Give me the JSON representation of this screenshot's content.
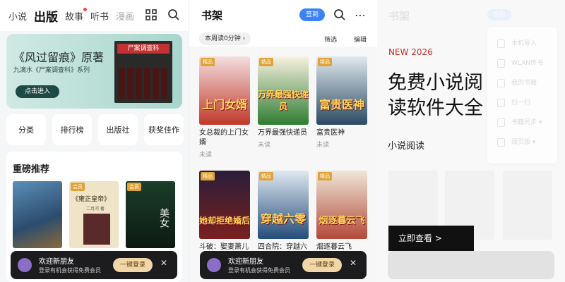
{
  "panel1": {
    "tabs": [
      "小说",
      "出版",
      "故事",
      "听书",
      "漫画"
    ],
    "active_tab": "出版",
    "banner": {
      "title": "《风过留痕》原著",
      "subtitle": "九滴水《尸案调查科》系列",
      "button": "点击进入",
      "book_label": "尸案调查科"
    },
    "categories": [
      "分类",
      "排行榜",
      "出版社",
      "获奖佳作"
    ],
    "section_title": "重磅推荐",
    "covers": [
      {
        "tag": ""
      },
      {
        "tag": "会员",
        "title": "《雍正皇帝》",
        "author": "二月河 著"
      },
      {
        "tag": "会员",
        "title": "美女"
      }
    ],
    "login": {
      "title": "欢迎新朋友",
      "subtitle": "登录有机会获得免费会员",
      "button": "一键登录"
    }
  },
  "panel2": {
    "title": "书架",
    "sign_button": "签到",
    "reading_time": "本周读0分钟",
    "filter": "筛选",
    "edit": "编辑",
    "books": [
      {
        "tag": "精品",
        "cover_text": "上门女婿",
        "title": "女总裁的上门女婿",
        "status": "未读",
        "colors": [
          "#f3dfdf",
          "#c0392b"
        ]
      },
      {
        "tag": "精品",
        "cover_text": "万界最强快递员",
        "title": "万界最强快递员",
        "status": "未读",
        "colors": [
          "#f8f1e0",
          "#2e7d32"
        ]
      },
      {
        "tag": "精品",
        "cover_text": "富贵医神",
        "title": "富贵医神",
        "status": "未读",
        "colors": [
          "#e0e9ee",
          "#2a4a62"
        ]
      },
      {
        "tag": "精品",
        "cover_text": "她却拒绝婚后",
        "title": "斗破：娶妻萧儿",
        "status": "",
        "colors": [
          "#2a1e3a",
          "#7a2020"
        ]
      },
      {
        "tag": "精品",
        "cover_text": "穿越六零",
        "title": "四合院：穿越六",
        "status": "",
        "colors": [
          "#dfe9f1",
          "#244c7a"
        ]
      },
      {
        "tag": "精品",
        "cover_text": "烟逐暮云飞",
        "title": "烟逐暮云飞",
        "status": "",
        "colors": [
          "#efe7d8",
          "#b24a3a"
        ]
      }
    ],
    "login": {
      "title": "欢迎新朋友",
      "subtitle": "登录有机会获得免费会员",
      "button": "一键登录"
    }
  },
  "panel3": {
    "tag": "NEW 2026",
    "headline": "免费小说阅读软件大全",
    "sub": "小说阅读",
    "cta": "立即查看 >",
    "menu": [
      "本机导入",
      "WLAN传书",
      "我的书籍",
      "扫一扫",
      "书籍同步 ▾",
      "阅页版 ▾"
    ],
    "header_title": "书架",
    "sign_button": "签到"
  }
}
